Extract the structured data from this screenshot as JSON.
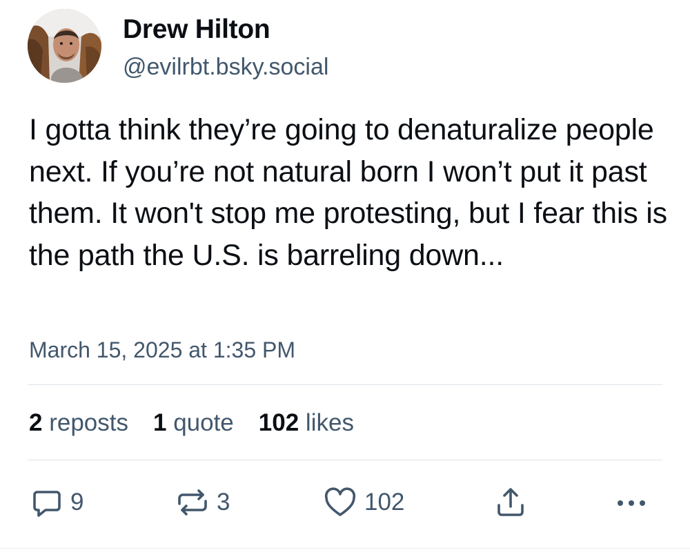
{
  "author": {
    "name": "Drew Hilton",
    "handle": "@evilrbt.bsky.social"
  },
  "post": {
    "text": "I gotta think they’re going to denaturalize people next. If you’re not natural born I won’t put it past them. It won't stop me protesting, but I fear this is the path the U.S. is barreling down...",
    "timestamp": "March 15, 2025 at 1:35 PM"
  },
  "stats": {
    "reposts_count": "2",
    "reposts_label": "reposts",
    "quotes_count": "1",
    "quotes_label": "quote",
    "likes_count": "102",
    "likes_label": "likes"
  },
  "actions": {
    "reply_count": "9",
    "repost_count": "3",
    "like_count": "102",
    "reply_icon": "reply-bubble-icon",
    "repost_icon": "repost-arrows-icon",
    "like_icon": "heart-icon",
    "share_icon": "share-upload-icon",
    "more_icon": "more-dots-icon"
  },
  "colors": {
    "text_primary": "#0b0f14",
    "text_secondary": "#42576c",
    "divider": "#dfe4ea"
  }
}
